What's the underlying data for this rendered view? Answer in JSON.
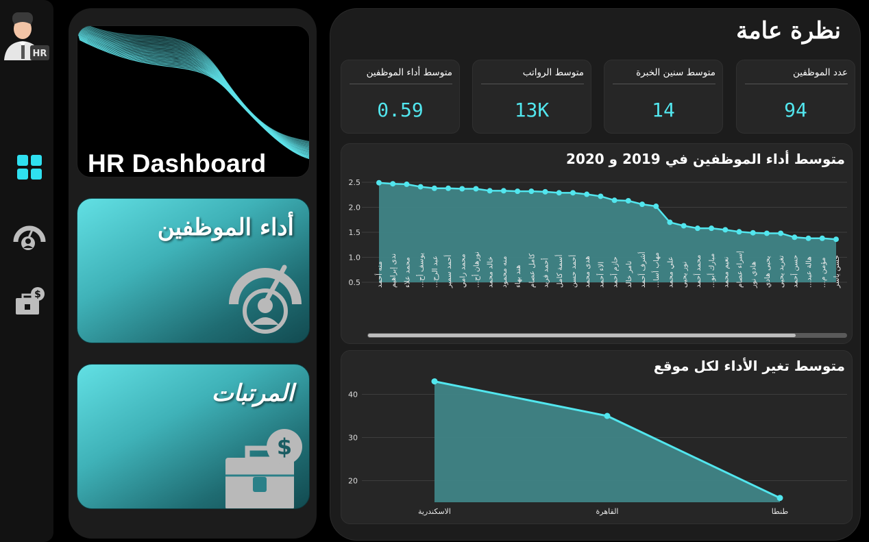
{
  "sidebar": {
    "avatar_badge": "HR",
    "icons": [
      "dashboard-grid-icon",
      "performance-gauge-icon",
      "salary-briefcase-icon"
    ],
    "active_color": "#2fe0f0",
    "inactive_color": "#bdbdbd"
  },
  "banner": {
    "title": "HR Dashboard",
    "accent": "#5fe3ea"
  },
  "nav_cards": {
    "performance": "أداء الموظفين",
    "salaries": "المرتبات"
  },
  "overview": {
    "title": "نظرة عامة",
    "kpis": [
      {
        "label": "عدد الموظفين",
        "value": "94"
      },
      {
        "label": "متوسط سنين الخبرة",
        "value": "14"
      },
      {
        "label": "متوسط الرواتب",
        "value": "13K"
      },
      {
        "label": "متوسط أداء الموظفين",
        "value": "0.59"
      }
    ]
  },
  "chart_data": [
    {
      "type": "area",
      "title": "متوسط أداء الموظفين في 2019 و 2020",
      "ylim": [
        0.5,
        2.5
      ],
      "yticks": [
        "2.5",
        "2.0",
        "1.5",
        "1.0",
        "0.5"
      ],
      "grid": true,
      "color": "#52e6ee",
      "x": [
        "منه أحمد",
        "ندى إبراهيم",
        "محمد علاء",
        "يوسف أح...",
        "عبد الرح...",
        "أحمد سمير",
        "محمد رامي",
        "نورهان أح...",
        "خالد محمد",
        "منه محمود",
        "هند بهاء",
        "كامل عصام",
        "أحمد فريد",
        "أسمة كامل",
        "أحمد حسن",
        "هدى محمد",
        "الاء أحمد",
        "حازم أحمد",
        "تامر خالد",
        "أشرف أحمد",
        "مهاب أسا...",
        "علي محمد",
        "نور يحيى",
        "محمد أحمد",
        "مبارك أبو...",
        "نعيم محمد",
        "إسراء عصام",
        "هادي نور",
        "يحيى هادي",
        "تغريد يحيى",
        "حسن أحمد",
        "هالة عبد...",
        "مؤمن م...",
        "حسن ياسر"
      ],
      "values": [
        2.49,
        2.47,
        2.46,
        2.41,
        2.38,
        2.38,
        2.37,
        2.37,
        2.33,
        2.33,
        2.32,
        2.32,
        2.31,
        2.29,
        2.29,
        2.26,
        2.22,
        2.14,
        2.13,
        2.06,
        2.02,
        1.7,
        1.63,
        1.58,
        1.58,
        1.55,
        1.51,
        1.49,
        1.48,
        1.48,
        1.4,
        1.38,
        1.38,
        1.36
      ]
    },
    {
      "type": "area",
      "title": "متوسط تغير الأداء لكل موقع",
      "ylim": [
        15,
        45
      ],
      "yticks": [
        "40",
        "30",
        "20"
      ],
      "grid": true,
      "color": "#52e6ee",
      "x": [
        "الاسكندرية",
        "القاهرة",
        "طنطا"
      ],
      "values": [
        43,
        35,
        16
      ]
    }
  ]
}
